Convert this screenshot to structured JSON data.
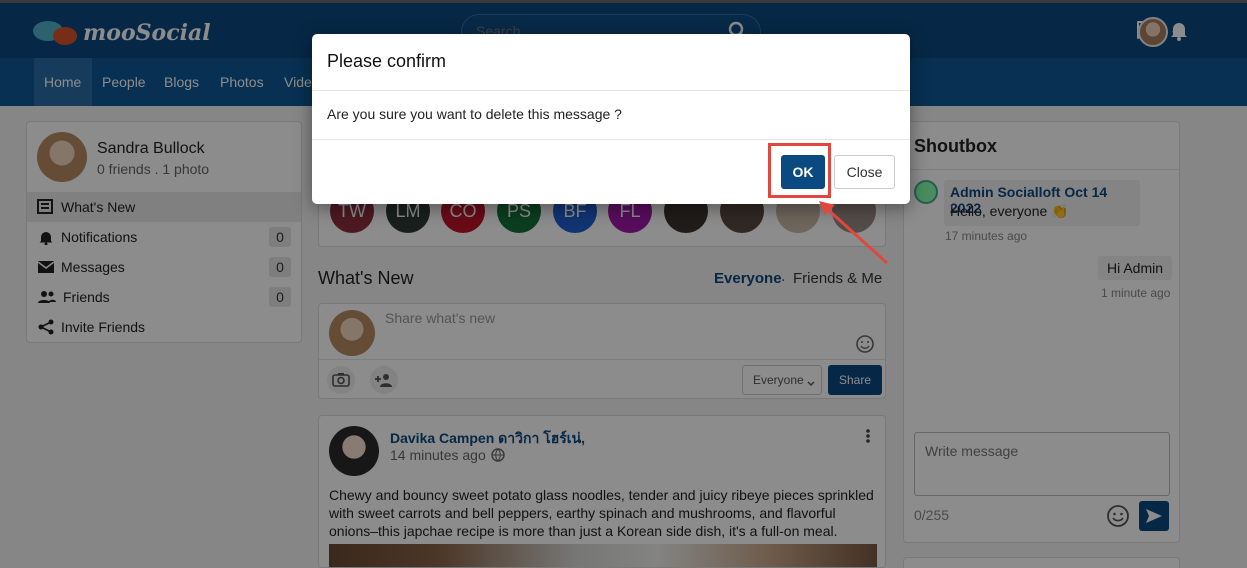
{
  "header": {
    "logo_text": "mooSocial",
    "search_placeholder": "Search"
  },
  "nav": {
    "items": [
      "Home",
      "People",
      "Blogs",
      "Photos",
      "Vide"
    ],
    "active": "Home"
  },
  "profile": {
    "name": "Sandra Bullock",
    "meta": "0 friends . 1 photo"
  },
  "menu": [
    {
      "label": "What's New",
      "count": ""
    },
    {
      "label": "Notifications",
      "count": "0"
    },
    {
      "label": "Messages",
      "count": "0"
    },
    {
      "label": "Friends",
      "count": "0"
    },
    {
      "label": "Invite Friends",
      "count": ""
    }
  ],
  "people": {
    "initials": [
      "TW",
      "LM",
      "CO",
      "PS",
      "BF",
      "FL"
    ]
  },
  "feed": {
    "title": "What's New",
    "filter_everyone": "Everyone",
    "filter_sep": ".",
    "filter_friends": "Friends & Me"
  },
  "composer": {
    "placeholder": "Share what's new",
    "privacy": "Everyone",
    "share_label": "Share"
  },
  "post": {
    "author": "Davika Campen ดาวิกา โฮร์เน่,",
    "time": "14 minutes ago",
    "body": "Chewy and bouncy sweet potato glass noodles, tender and juicy ribeye pieces sprinkled with sweet carrots and bell peppers, earthy spinach and mushrooms, and flavorful onions–this japchae recipe is more than just a Korean side dish, it's a full-on meal."
  },
  "shoutbox": {
    "title": "Shoutbox",
    "msg1_author": "Admin Socialloft Oct 14 2022",
    "msg1_text": "Hello, everyone 👏",
    "msg1_time": "17 minutes ago",
    "msg2_text": "Hi Admin",
    "msg2_time": "1 minute ago",
    "input_placeholder": "Write message",
    "char_count": "0/255"
  },
  "modal": {
    "title": "Please confirm",
    "body": "Are you sure you want to delete this message ?",
    "ok_label": "OK",
    "close_label": "Close"
  },
  "colors": {
    "brand": "#0b4a80",
    "highlight": "#e0483f"
  }
}
